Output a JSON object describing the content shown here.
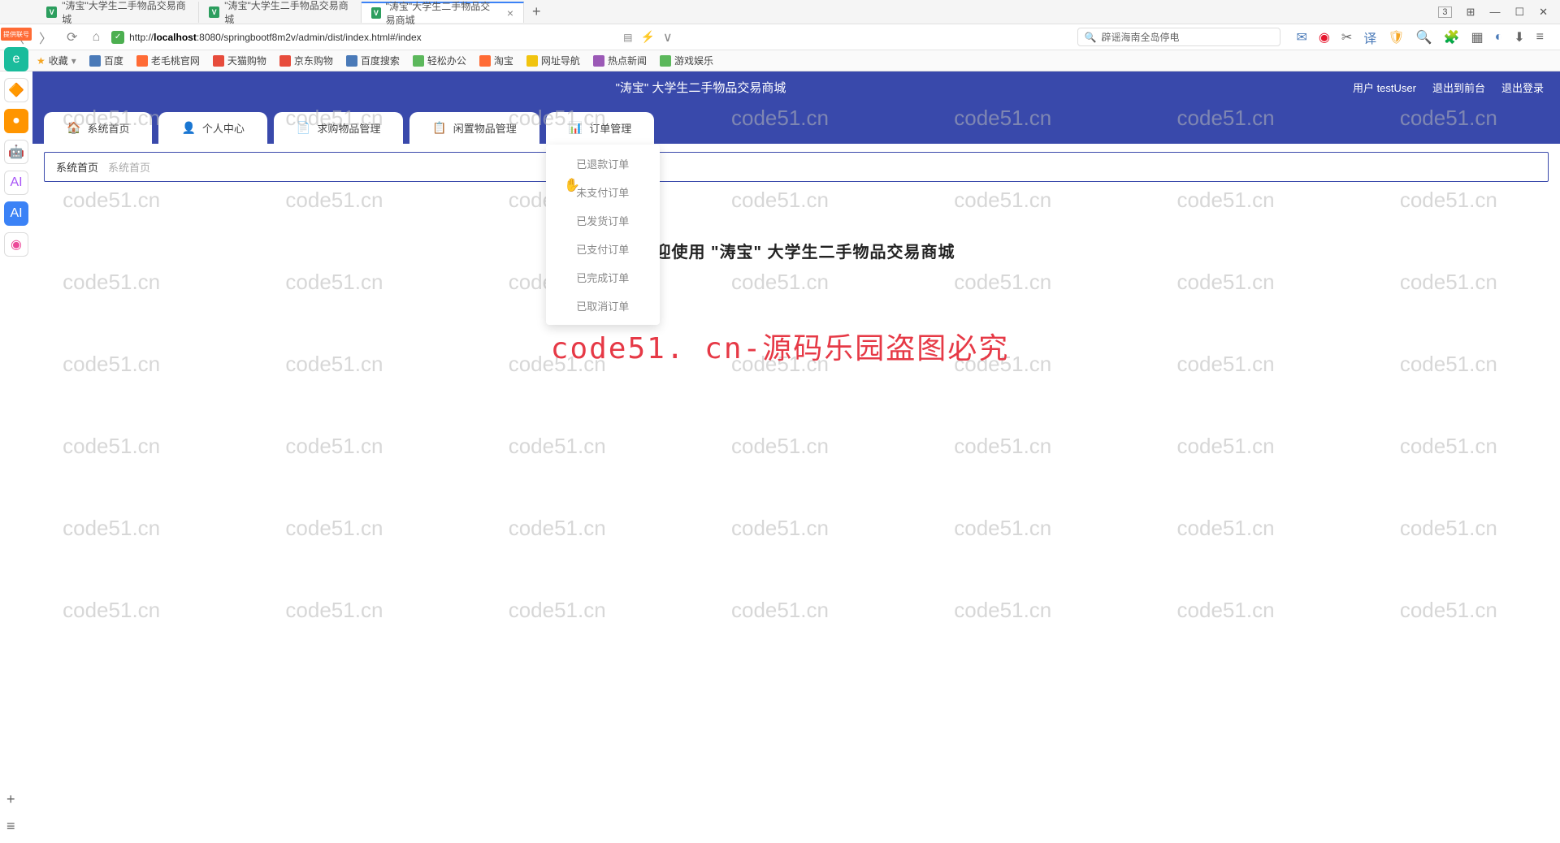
{
  "browser": {
    "tabs": [
      {
        "title": "\"涛宝\"大学生二手物品交易商城"
      },
      {
        "title": "\"涛宝\"大学生二手物品交易商城"
      },
      {
        "title": "\"涛宝\"大学生二手物品交易商城"
      }
    ],
    "url_prefix": "http://",
    "url_host": "localhost",
    "url_port": ":8080",
    "url_path": "/springbootf8m2v/admin/dist/index.html#/index",
    "search_placeholder": "辟谣海南全岛停电",
    "window_numeric": "3"
  },
  "bookmarks": {
    "fav": "收藏",
    "items": [
      "百度",
      "老毛桃官网",
      "天猫购物",
      "京东购物",
      "百度搜索",
      "轻松办公",
      "淘宝",
      "网址导航",
      "热点新闻",
      "游戏娱乐"
    ]
  },
  "left_rail": {
    "badge": "提供联号"
  },
  "header": {
    "title": "\"涛宝\" 大学生二手物品交易商城",
    "user_label": "用户 testUser",
    "exit_front": "退出到前台",
    "logout": "退出登录"
  },
  "nav": {
    "tabs": [
      {
        "icon": "home",
        "label": "系统首页"
      },
      {
        "icon": "user",
        "label": "个人中心"
      },
      {
        "icon": "doc",
        "label": "求购物品管理"
      },
      {
        "icon": "doc",
        "label": "闲置物品管理"
      },
      {
        "icon": "bar",
        "label": "订单管理"
      }
    ],
    "dropdown": [
      "已退款订单",
      "未支付订单",
      "已发货订单",
      "已支付订单",
      "已完成订单",
      "已取消订单"
    ]
  },
  "breadcrumb": {
    "main": "系统首页",
    "sub": "系统首页"
  },
  "content": {
    "welcome": "欢迎使用 \"涛宝\" 大学生二手物品交易商城"
  },
  "watermark": {
    "text": "code51.cn",
    "main": "code51. cn-源码乐园盗图必究"
  }
}
